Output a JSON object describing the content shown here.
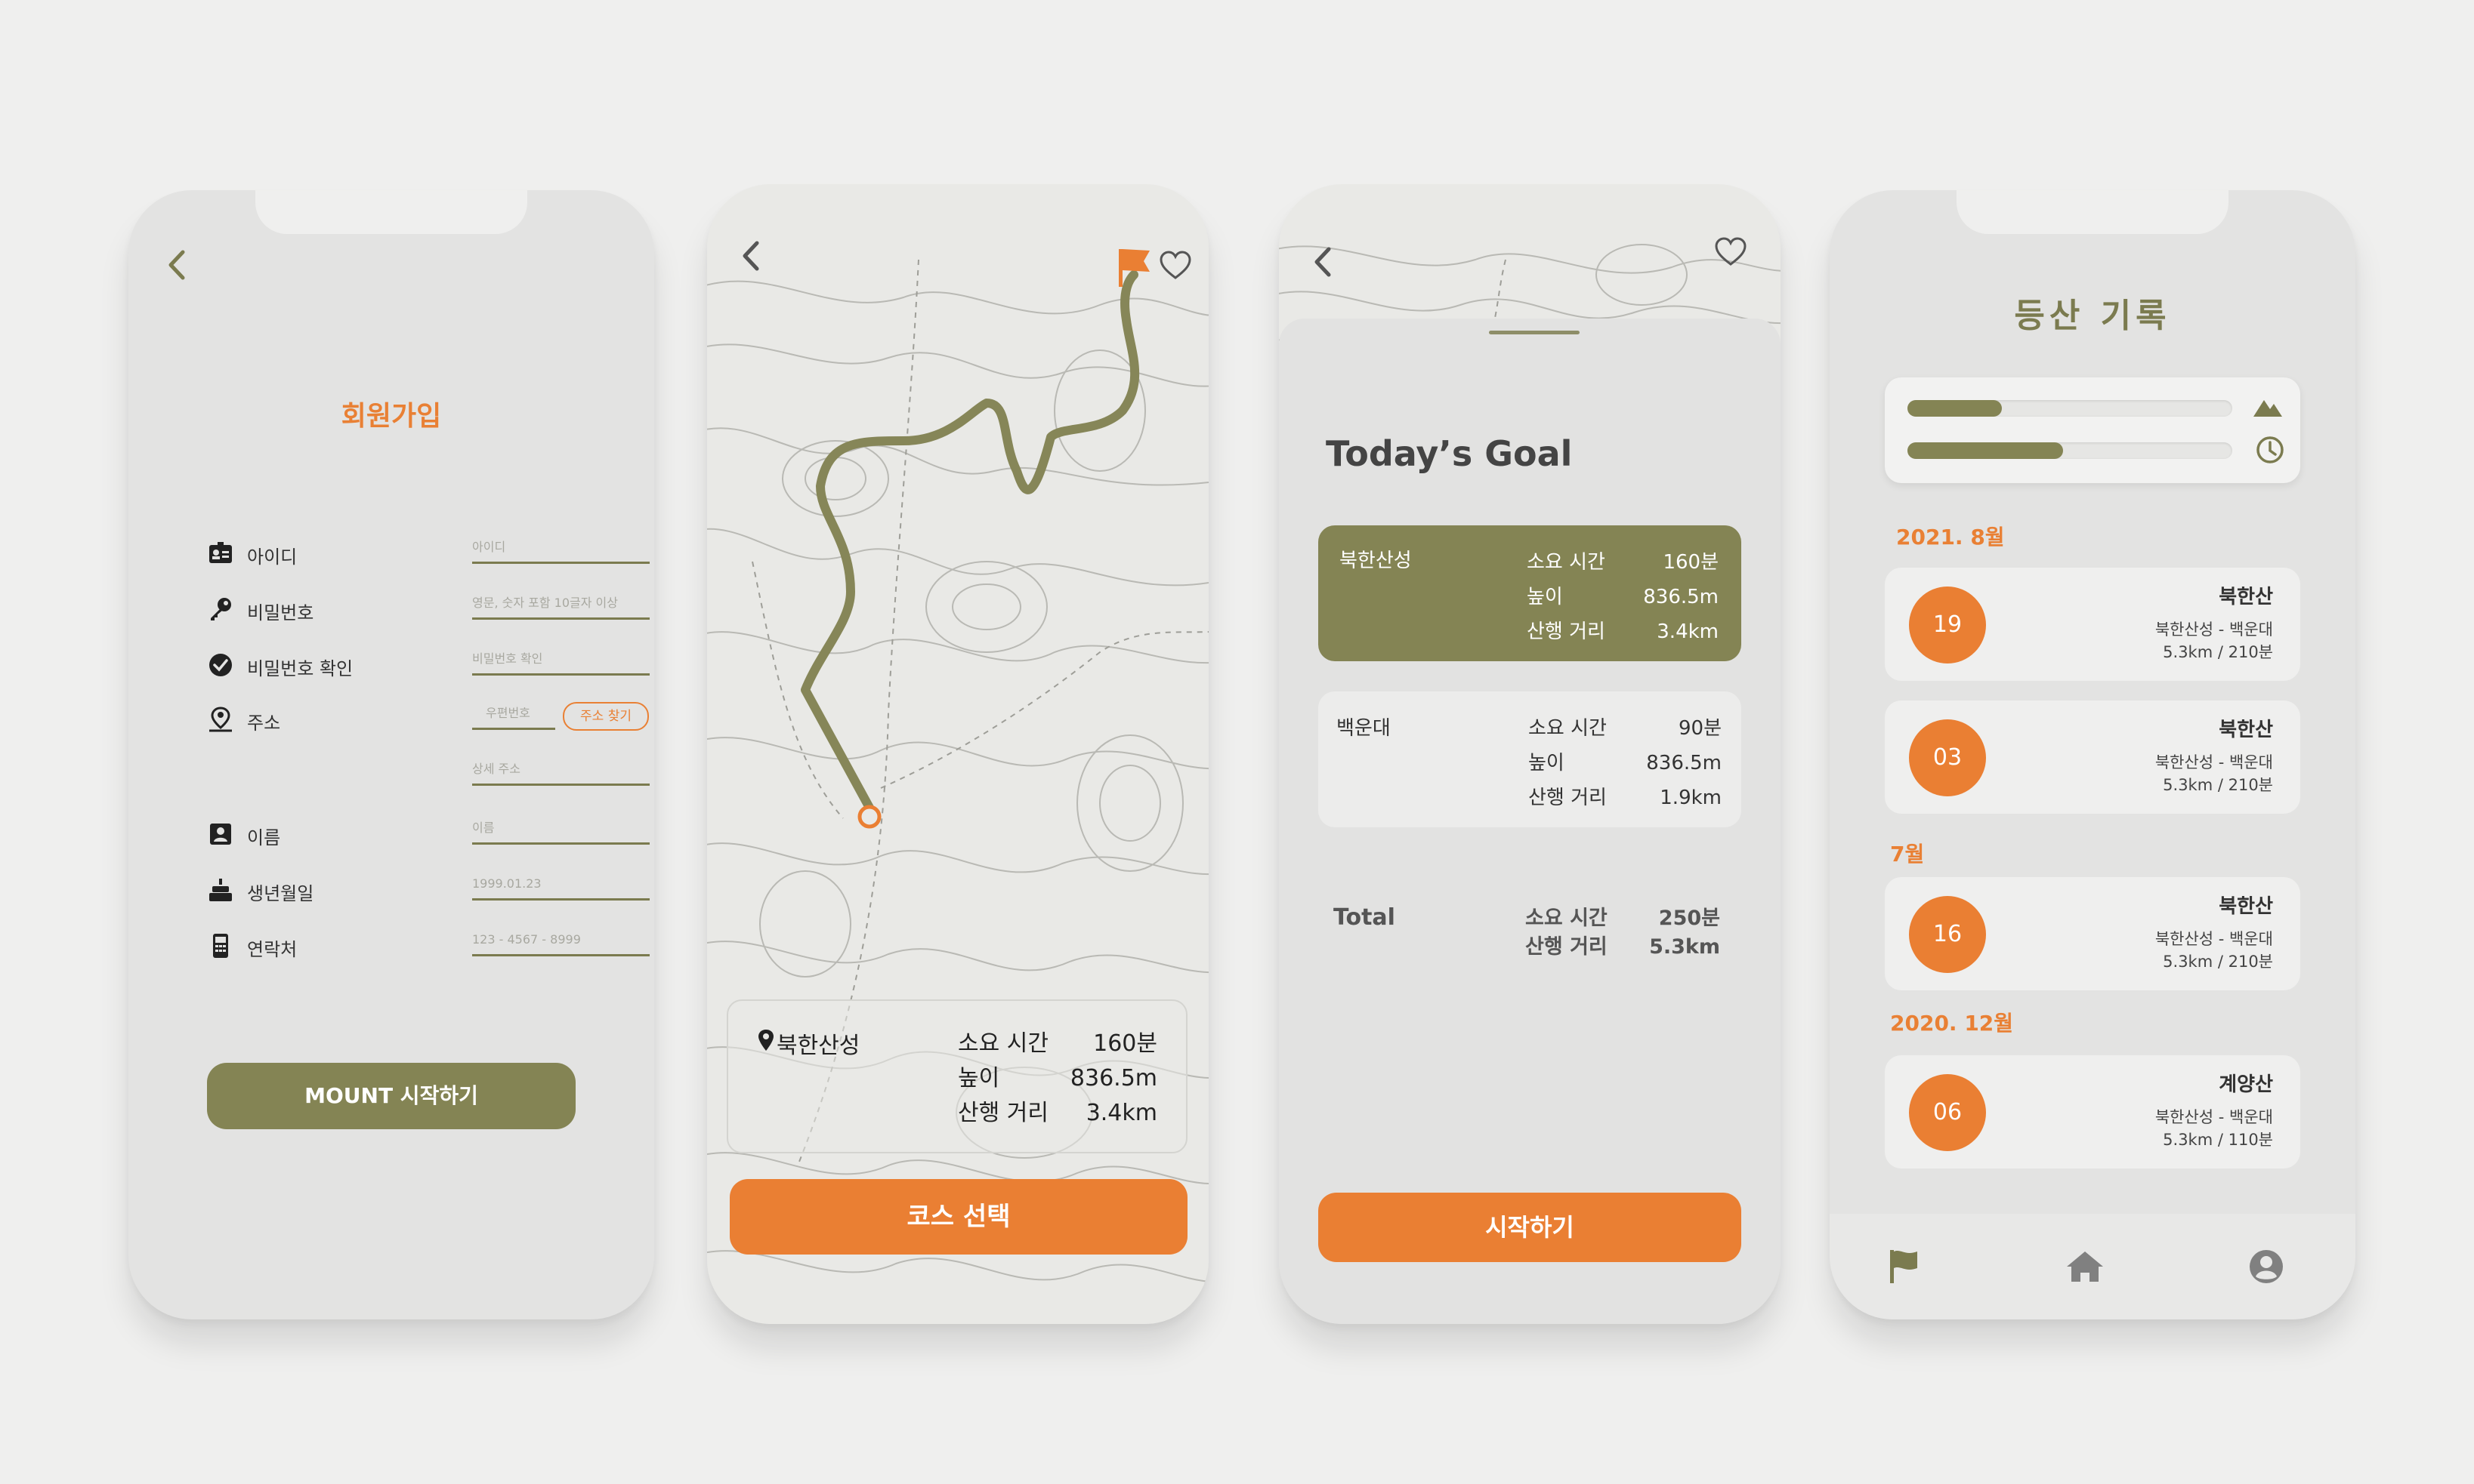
{
  "signup": {
    "title": "회원가입",
    "fields": [
      {
        "label": "아이디",
        "placeholder": "아이디",
        "icon": "id-card-icon"
      },
      {
        "label": "비밀번호",
        "placeholder": "영문, 숫자 포함 10글자 이상",
        "icon": "key-icon"
      },
      {
        "label": "비밀번호 확인",
        "placeholder": "비밀번호 확인",
        "icon": "check-circle-icon"
      },
      {
        "label": "주소",
        "placeholder": "우편번호",
        "icon": "location-person-icon"
      },
      {
        "label": "이름",
        "placeholder": "이름",
        "icon": "id-badge-icon"
      },
      {
        "label": "생년월일",
        "placeholder": "1999.01.23",
        "icon": "cake-icon"
      },
      {
        "label": "연락처",
        "placeholder": "123 - 4567 - 8999",
        "icon": "phone-icon"
      }
    ],
    "address_search_label": "주소 찾기",
    "address_detail_placeholder": "상세 주소",
    "submit_label": "MOUNT 시작하기",
    "accent": "#e98034",
    "brand": "#7b7b4f"
  },
  "map": {
    "place": "북한산성",
    "rows": [
      {
        "label": "소요 시간",
        "value": "160분"
      },
      {
        "label": "높이",
        "value": "836.5m"
      },
      {
        "label": "산행 거리",
        "value": "3.4km"
      }
    ],
    "select_label": "코스 선택"
  },
  "goal": {
    "title": "Today’s Goal",
    "courses": [
      {
        "name": "북한산성",
        "rows": [
          {
            "label": "소요 시간",
            "value": "160분"
          },
          {
            "label": "높이",
            "value": "836.5m"
          },
          {
            "label": "산행 거리",
            "value": "3.4km"
          }
        ]
      },
      {
        "name": "백운대",
        "rows": [
          {
            "label": "소요 시간",
            "value": "90분"
          },
          {
            "label": "높이",
            "value": "836.5m"
          },
          {
            "label": "산행 거리",
            "value": "1.9km"
          }
        ]
      }
    ],
    "total": {
      "label": "Total",
      "rows": [
        {
          "label": "소요 시간",
          "value": "250분"
        },
        {
          "label": "산행 거리",
          "value": "5.3km"
        }
      ]
    },
    "start_label": "시작하기"
  },
  "records": {
    "title": "등산 기록",
    "progress": [
      0.29,
      0.48
    ],
    "months": [
      "2021. 8월",
      "7월",
      "2020. 12월"
    ],
    "items": [
      {
        "day": "19",
        "name": "북한산",
        "route": "북한산성 - 백운대",
        "dist": "5.3km /  210분"
      },
      {
        "day": "03",
        "name": "북한산",
        "route": "북한산성 - 백운대",
        "dist": "5.3km /  210분"
      },
      {
        "day": "16",
        "name": "북한산",
        "route": "북한산성 - 백운대",
        "dist": "5.3km /  210분"
      },
      {
        "day": "06",
        "name": "계양산",
        "route": "북한산성 - 백운대",
        "dist": "5.3km /  110분"
      }
    ]
  }
}
